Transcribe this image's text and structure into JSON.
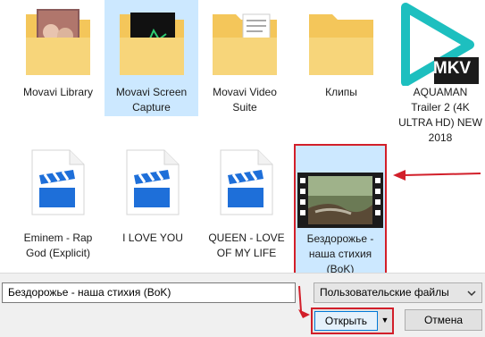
{
  "files": [
    {
      "label": "Movavi Library",
      "icon": "folder-photo-icon"
    },
    {
      "label": "Movavi Screen Capture",
      "icon": "folder-screenshot-icon"
    },
    {
      "label": "Movavi Video Suite",
      "icon": "folder-document-icon"
    },
    {
      "label": "Клипы",
      "icon": "folder-icon"
    },
    {
      "label": "AQUAMAN Trailer 2 (4K ULTRA HD) NEW 2018",
      "icon": "mkv-play-icon",
      "badge": "MKV"
    },
    {
      "label": "Eminem - Rap God (Explicit)",
      "icon": "video-clapper-icon"
    },
    {
      "label": "I LOVE YOU",
      "icon": "video-clapper-icon"
    },
    {
      "label": "QUEEN - LOVE OF MY LIFE",
      "icon": "video-clapper-icon"
    },
    {
      "label": "Бездорожье - наша стихия (BoK)",
      "icon": "video-film-thumbnail-icon"
    }
  ],
  "filename_value": "Бездорожье - наша стихия (BoK)",
  "filter_value": "Пользовательские файлы",
  "buttons": {
    "open": "Открыть",
    "cancel": "Отмена"
  },
  "colors": {
    "selection": "#cce8ff",
    "highlight": "#d21f2a",
    "accent": "#0078d7",
    "mkv": "#1dbfbf"
  }
}
